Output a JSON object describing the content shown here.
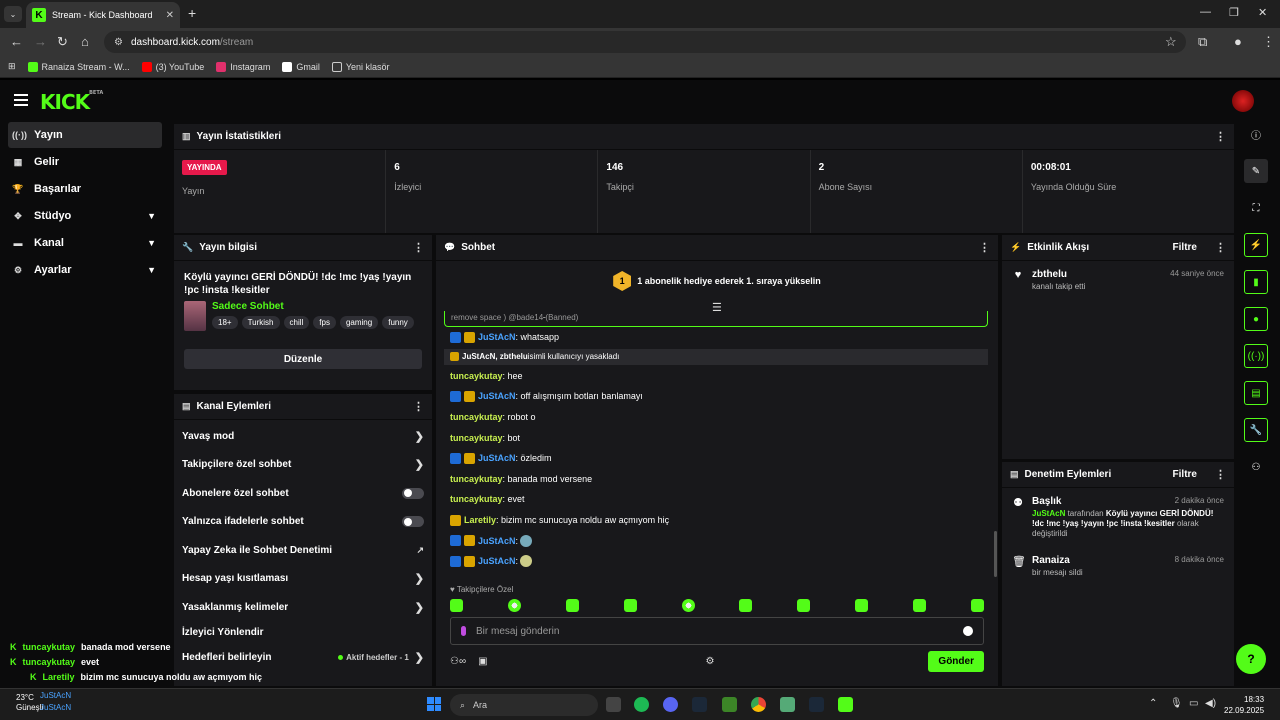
{
  "browser": {
    "tab_title": "Stream - Kick Dashboard",
    "url_host": "dashboard.kick.com",
    "url_path": "/stream",
    "bookmarks": [
      {
        "label": "Ranaiza Stream - W...",
        "color": "#53fc18"
      },
      {
        "label": "(3) YouTube",
        "color": "#ff0000"
      },
      {
        "label": "Instagram",
        "color": "#e1306c"
      },
      {
        "label": "Gmail",
        "color": "#ffffff"
      },
      {
        "label": "Yeni klasör",
        "color": "#cccccc"
      }
    ]
  },
  "brand": {
    "logo": "KICK",
    "beta": "BETA",
    "accent": "#53fc18"
  },
  "sidebar": {
    "items": [
      {
        "label": "Yayın",
        "icon": "broadcast-icon"
      },
      {
        "label": "Gelir",
        "icon": "revenue-icon"
      },
      {
        "label": "Başarılar",
        "icon": "trophy-icon"
      },
      {
        "label": "Stüdyo",
        "icon": "studio-icon"
      },
      {
        "label": "Kanal",
        "icon": "channel-icon"
      },
      {
        "label": "Ayarlar",
        "icon": "gear-icon"
      }
    ]
  },
  "stats": {
    "title": "Yayın İstatistikleri",
    "live_badge": "YAYINDA",
    "items": [
      {
        "value": "",
        "label": "Yayın"
      },
      {
        "value": "6",
        "label": "İzleyici"
      },
      {
        "value": "146",
        "label": "Takipçi"
      },
      {
        "value": "2",
        "label": "Abone Sayısı"
      },
      {
        "value": "00:08:01",
        "label": "Yayında Olduğu Süre"
      }
    ]
  },
  "stream_info": {
    "header": "Yayın bilgisi",
    "title": "Köylü yayıncı GERİ DÖNDÜ! !dc !mc !yaş !yayın !pc !insta !kesitler",
    "category": "Sadece Sohbet",
    "tags": [
      "18+",
      "Turkish",
      "chill",
      "fps",
      "gaming",
      "funny"
    ],
    "edit_label": "Düzenle"
  },
  "channel_actions": {
    "header": "Kanal Eylemleri",
    "rows": [
      {
        "label": "Yavaş mod",
        "control": "arrow"
      },
      {
        "label": "Takipçilere özel sohbet",
        "control": "arrow"
      },
      {
        "label": "Abonelere özel sohbet",
        "control": "toggle"
      },
      {
        "label": "Yalnızca ifadelerle sohbet",
        "control": "toggle"
      },
      {
        "label": "Yapay Zeka ile Sohbet Denetimi",
        "control": "external"
      },
      {
        "label": "Hesap yaşı kısıtlaması",
        "control": "arrow"
      },
      {
        "label": "Yasaklanmış kelimeler",
        "control": "arrow"
      },
      {
        "label": "İzleyici Yönlendir",
        "control": "none"
      },
      {
        "label": "Hedefleri belirleyin",
        "control": "goal"
      }
    ],
    "goal_status": "Aktif hedefler - 1"
  },
  "chat": {
    "header": "Sohbet",
    "hex_number": "1",
    "banner": "1 abonelik hediye ederek 1. sıraya yükselin",
    "banned_text": "remove space ) @bade14",
    "banned_tag": "(Banned)",
    "messages": [
      {
        "user": "JuStAcN",
        "text": ": whatsapp",
        "type": "mod"
      },
      {
        "user": "JuStAcN, zbthelu",
        "text": " isimli kullanıcıyı yasakladı",
        "type": "system"
      },
      {
        "user": "tuncaykutay",
        "text": ": hee",
        "type": "plain"
      },
      {
        "user": "JuStAcN",
        "text": ": off alışmışım botları banlamayı",
        "type": "mod"
      },
      {
        "user": "tuncaykutay",
        "text": ": robot o",
        "type": "plain"
      },
      {
        "user": "tuncaykutay",
        "text": ": bot",
        "type": "plain"
      },
      {
        "user": "JuStAcN",
        "text": ": özledim",
        "type": "mod"
      },
      {
        "user": "tuncaykutay",
        "text": ": banada mod versene",
        "type": "plain"
      },
      {
        "user": "tuncaykutay",
        "text": ": evet",
        "type": "plain"
      },
      {
        "user": "Laretily",
        "text": ": bizim mc sunucuya noldu aw açmıyom hiç",
        "type": "crown"
      },
      {
        "user": "JuStAcN",
        "text": ":",
        "type": "mod-emote"
      },
      {
        "user": "JuStAcN",
        "text": ":",
        "type": "mod-emote"
      }
    ],
    "followers_only": "Takipçilere Özel",
    "input_placeholder": "Bir mesaj gönderin",
    "send_label": "Gönder"
  },
  "activity": {
    "header": "Etkinlik Akışı",
    "filter": "Filtre",
    "items": [
      {
        "name": "zbthelu",
        "time": "44 saniye önce",
        "sub": "kanalı takip etti"
      }
    ]
  },
  "moderation": {
    "header": "Denetim Eylemleri",
    "filter": "Filtre",
    "items": [
      {
        "name": "Başlık",
        "time": "2 dakika önce",
        "actor": "JuStAcN",
        "mid": " tarafından ",
        "title": "Köylü yayıncı GERİ DÖNDÜ! !dc !mc !yaş !yayın !pc !insta !kesitler",
        "end": " olarak değiştirildi"
      },
      {
        "name": "Ranaiza",
        "time": "8 dakika önce",
        "sub": "bir mesajı sildi"
      }
    ]
  },
  "overlay_chat": [
    {
      "user": "tuncaykutay",
      "text": "banada mod versene"
    },
    {
      "user": "tuncaykutay",
      "text": "evet"
    },
    {
      "user": "Laretily",
      "text": "bizim mc sunucuya noldu aw açmıyom hiç"
    },
    {
      "user": "JuStAcN",
      "text": ""
    },
    {
      "user": "JuStAcN",
      "text": ""
    }
  ],
  "taskbar": {
    "temp": "23°C",
    "weather": "Güneşli",
    "search": "Ara",
    "time": "18:33",
    "date": "22.09.2025"
  }
}
